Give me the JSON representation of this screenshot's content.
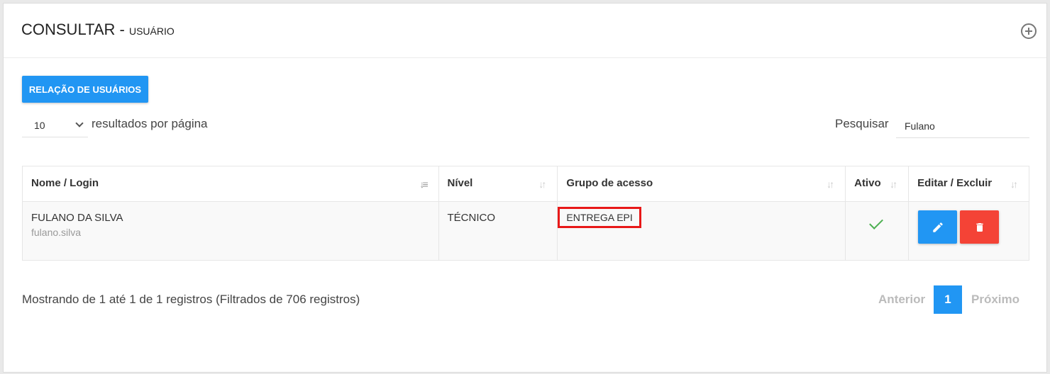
{
  "header": {
    "title": "CONSULTAR - ",
    "subtitle": "USUÁRIO"
  },
  "toolbar": {
    "report_button": "RELAÇÃO DE USUÁRIOS"
  },
  "length": {
    "value": "10",
    "label": "resultados por página"
  },
  "search": {
    "label": "Pesquisar",
    "value": "Fulano"
  },
  "table": {
    "columns": [
      "Nome / Login",
      "Nível",
      "Grupo de acesso",
      "Ativo",
      "Editar / Excluir"
    ],
    "rows": [
      {
        "name": "FULANO DA SILVA",
        "login": "fulano.silva",
        "level": "TÉCNICO",
        "group": "ENTREGA EPI",
        "active": true
      }
    ]
  },
  "footer": {
    "info": "Mostrando de 1 até 1 de 1 registros (Filtrados de 706 registros)",
    "prev": "Anterior",
    "page": "1",
    "next": "Próximo"
  },
  "colors": {
    "primary": "#2196f3",
    "danger": "#f44336",
    "success": "#4caf50",
    "highlight": "#e81818"
  },
  "icons": {
    "add": "plus-circle-icon",
    "edit": "pencil-icon",
    "delete": "trash-icon",
    "active": "check-icon"
  }
}
